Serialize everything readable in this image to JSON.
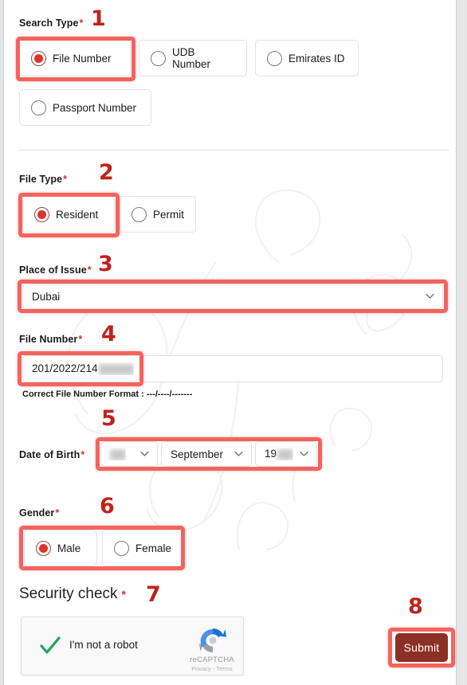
{
  "form": {
    "search_type": {
      "label": "Search Type",
      "required_mark": "*",
      "step": "1",
      "options": [
        {
          "label": "File Number",
          "selected": true
        },
        {
          "label": "UDB Number",
          "selected": false
        },
        {
          "label": "Emirates ID",
          "selected": false
        },
        {
          "label": "Passport Number",
          "selected": false
        }
      ]
    },
    "file_type": {
      "label": "File Type",
      "required_mark": "*",
      "step": "2",
      "options": [
        {
          "label": "Resident",
          "selected": true
        },
        {
          "label": "Permit",
          "selected": false
        }
      ]
    },
    "place_of_issue": {
      "label": "Place of Issue",
      "required_mark": "*",
      "step": "3",
      "value": "Dubai",
      "chevron": "chevron-down-icon"
    },
    "file_number": {
      "label": "File Number",
      "required_mark": "*",
      "step": "4",
      "value": "201/2022/214",
      "value_redacted": true,
      "hint": "Correct File Number Format : ---/----/-------"
    },
    "date_of_birth": {
      "label": "Date of Birth",
      "required_mark": "*",
      "step": "5",
      "day": "",
      "day_redacted": true,
      "month": "September",
      "year": "19",
      "year_redacted": true
    },
    "gender": {
      "label": "Gender",
      "required_mark": "*",
      "step": "6",
      "options": [
        {
          "label": "Male",
          "selected": true
        },
        {
          "label": "Female",
          "selected": false
        }
      ]
    },
    "security_check": {
      "label": "Security check",
      "required_mark": "*",
      "step": "7",
      "recaptcha": {
        "checkbox_label": "I'm not a robot",
        "checked": true,
        "brand": "reCAPTCHA",
        "terms": "Privacy - Terms",
        "check_icon": "green-checkmark-icon",
        "logo_icon": "recaptcha-logo-icon"
      }
    },
    "submit": {
      "label": "Submit",
      "step": "8"
    }
  },
  "colors": {
    "annotation_red": "#f4635e",
    "annotation_number_red": "#c0221b",
    "required_red": "#d0342c",
    "radio_fill": "#e0322c",
    "submit_bg": "#8c2f25",
    "recaptcha_check_green": "#1fa463",
    "border_gray": "#e2e2e2"
  }
}
